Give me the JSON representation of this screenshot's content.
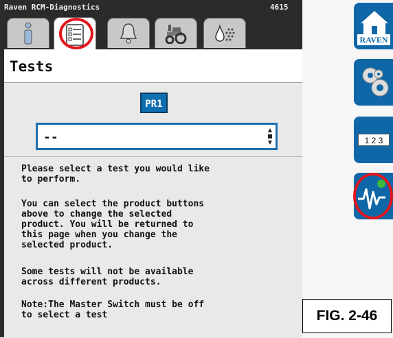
{
  "window": {
    "title": "Raven RCM-Diagnostics",
    "number": "4615"
  },
  "tabs": [
    {
      "name": "info",
      "icon": "info-icon"
    },
    {
      "name": "tests",
      "icon": "checklist-icon",
      "active": true
    },
    {
      "name": "alarms",
      "icon": "bell-icon"
    },
    {
      "name": "machine",
      "icon": "tractor-icon"
    },
    {
      "name": "products",
      "icon": "product-drop-icon"
    }
  ],
  "header": {
    "title": "Tests"
  },
  "product_button": {
    "label": "PR1"
  },
  "test_select": {
    "value": "--"
  },
  "instructions": {
    "p1": "Please select a test you would like\nto perform.",
    "p2": "You can select the product buttons\nabove to change the selected\nproduct. You will be returned to\nthis page when you change the\nselected product.",
    "p3": "Some tests will not be available\nacross different products.",
    "p4": "Note:The Master Switch must be off\nto select a test"
  },
  "sidebar": {
    "home_label": "RAVEN",
    "keypad_label": "1 2 3"
  },
  "figure_label": "FIG. 2-46",
  "colors": {
    "accent": "#0f67a8",
    "highlight": "#e3161d",
    "background": "#2b2b2b"
  }
}
